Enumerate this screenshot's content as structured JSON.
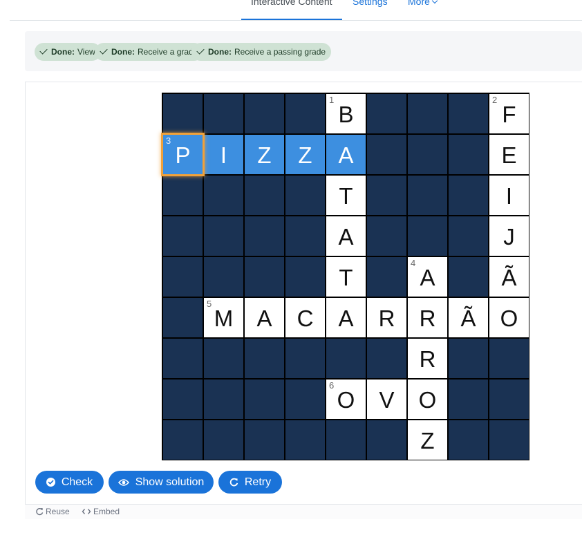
{
  "nav": {
    "tabs": [
      {
        "label": "Interactive Content"
      },
      {
        "label": "Settings"
      },
      {
        "label": "More"
      }
    ]
  },
  "badges": [
    {
      "status": "Done:",
      "label": "View"
    },
    {
      "status": "Done:",
      "label": "Receive a grade"
    },
    {
      "status": "Done:",
      "label": "Receive a passing grade"
    }
  ],
  "crossword": {
    "rows": 9,
    "cols": 9,
    "colors": {
      "dark": "#1a3253",
      "highlight": "#3d8fe0",
      "focus": "#f0a13a"
    },
    "cells": [
      {
        "r": 0,
        "c": 4,
        "letter": "B",
        "num": "1"
      },
      {
        "r": 0,
        "c": 8,
        "letter": "F",
        "num": "2"
      },
      {
        "r": 1,
        "c": 0,
        "letter": "P",
        "num": "3",
        "highlight": true,
        "focus": true
      },
      {
        "r": 1,
        "c": 1,
        "letter": "I",
        "highlight": true
      },
      {
        "r": 1,
        "c": 2,
        "letter": "Z",
        "highlight": true
      },
      {
        "r": 1,
        "c": 3,
        "letter": "Z",
        "highlight": true
      },
      {
        "r": 1,
        "c": 4,
        "letter": "A",
        "highlight": true
      },
      {
        "r": 1,
        "c": 8,
        "letter": "E"
      },
      {
        "r": 2,
        "c": 4,
        "letter": "T"
      },
      {
        "r": 2,
        "c": 8,
        "letter": "I"
      },
      {
        "r": 3,
        "c": 4,
        "letter": "A"
      },
      {
        "r": 3,
        "c": 8,
        "letter": "J"
      },
      {
        "r": 4,
        "c": 4,
        "letter": "T"
      },
      {
        "r": 4,
        "c": 6,
        "letter": "A",
        "num": "4"
      },
      {
        "r": 4,
        "c": 8,
        "letter": "Ã"
      },
      {
        "r": 5,
        "c": 1,
        "letter": "M",
        "num": "5"
      },
      {
        "r": 5,
        "c": 2,
        "letter": "A"
      },
      {
        "r": 5,
        "c": 3,
        "letter": "C"
      },
      {
        "r": 5,
        "c": 4,
        "letter": "A"
      },
      {
        "r": 5,
        "c": 5,
        "letter": "R"
      },
      {
        "r": 5,
        "c": 6,
        "letter": "R"
      },
      {
        "r": 5,
        "c": 7,
        "letter": "Ã"
      },
      {
        "r": 5,
        "c": 8,
        "letter": "O"
      },
      {
        "r": 6,
        "c": 6,
        "letter": "R"
      },
      {
        "r": 7,
        "c": 4,
        "letter": "O",
        "num": "6"
      },
      {
        "r": 7,
        "c": 5,
        "letter": "V"
      },
      {
        "r": 7,
        "c": 6,
        "letter": "O"
      },
      {
        "r": 8,
        "c": 6,
        "letter": "Z"
      }
    ]
  },
  "buttons": {
    "check": {
      "label": "Check",
      "icon": "check-circle-icon"
    },
    "show_solution": {
      "label": "Show solution",
      "icon": "eye-icon"
    },
    "retry": {
      "label": "Retry",
      "icon": "retry-icon"
    }
  },
  "footer": {
    "reuse": {
      "label": "Reuse",
      "icon": "refresh-icon"
    },
    "embed": {
      "label": "Embed",
      "icon": "code-icon"
    }
  }
}
